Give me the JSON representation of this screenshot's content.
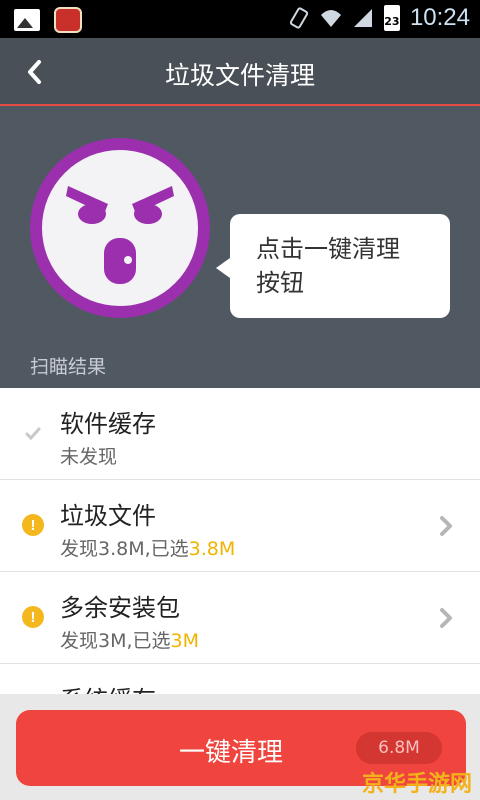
{
  "status_bar": {
    "time": "10:24",
    "battery": "23",
    "icons": [
      "image-icon",
      "app-icon",
      "rotate-icon",
      "wifi-icon",
      "signal-icon",
      "battery-icon"
    ]
  },
  "header": {
    "title": "垃圾文件清理",
    "back_icon": "chevron-left-icon"
  },
  "hero": {
    "mascot": "angry-face-icon",
    "bubble_line1": "点击一键清理",
    "bubble_line2": "按钮",
    "scan_label": "扫瞄结果"
  },
  "items": [
    {
      "title": "软件缓存",
      "sub_prefix": "未发现",
      "sub_highlight": "",
      "status": "check",
      "has_chevron": false
    },
    {
      "title": "垃圾文件",
      "sub_prefix": "发现3.8M,已选",
      "sub_highlight": "3.8M",
      "status": "warning",
      "has_chevron": true
    },
    {
      "title": "多余安装包",
      "sub_prefix": "发现3M,已选",
      "sub_highlight": "3M",
      "status": "warning",
      "has_chevron": true
    },
    {
      "title": "系统缓存",
      "sub_prefix": "",
      "sub_highlight": "",
      "status": "none",
      "has_chevron": false
    }
  ],
  "clean_button": {
    "label": "一键清理",
    "size": "6.8M"
  },
  "watermark": "京华手游网",
  "colors": {
    "accent_red": "#f0443e",
    "warning_yellow": "#f4b71e",
    "header_bg": "#495058",
    "mascot_purple": "#9b2fae"
  }
}
